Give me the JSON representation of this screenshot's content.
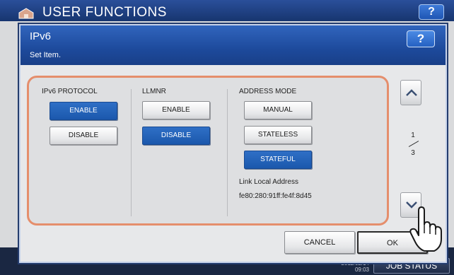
{
  "background": {
    "title": "USER FUNCTIONS",
    "help_label": "?",
    "date": "2011/02/14",
    "time": "09:03",
    "job_status_label": "JOB STATUS"
  },
  "dialog": {
    "title": "IPv6",
    "subtitle": "Set Item.",
    "help_label": "?"
  },
  "columns": {
    "ipv6_protocol": {
      "label": "IPv6 PROTOCOL",
      "options": [
        "ENABLE",
        "DISABLE"
      ],
      "selected": "ENABLE"
    },
    "llmnr": {
      "label": "LLMNR",
      "options": [
        "ENABLE",
        "DISABLE"
      ],
      "selected": "DISABLE"
    },
    "address_mode": {
      "label": "ADDRESS MODE",
      "options": [
        "MANUAL",
        "STATELESS",
        "STATEFUL"
      ],
      "selected": "STATEFUL",
      "link_local_label": "Link Local Address",
      "link_local_value": "fe80:280:91ff:fe4f:8d45"
    }
  },
  "pagination": {
    "current": "1",
    "total": "3"
  },
  "footer": {
    "cancel_label": "CANCEL",
    "ok_label": "OK"
  },
  "colors": {
    "selected_button": "#1f5cb0",
    "highlight_outline": "#e58e6c",
    "header_blue": "#1d4a9c"
  }
}
